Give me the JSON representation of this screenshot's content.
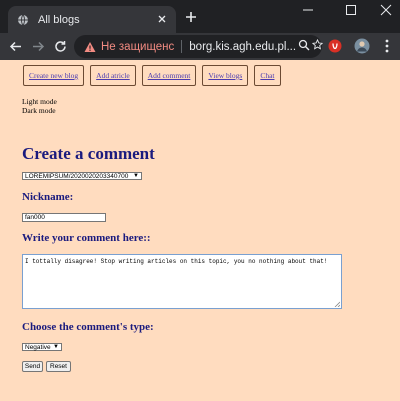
{
  "browser": {
    "tab": {
      "title": "All blogs",
      "favicon": "globe-icon"
    },
    "address_bar": {
      "security_label": "Не защищенс",
      "url": "borg.kis.agh.edu.pl..."
    }
  },
  "page": {
    "nav": [
      {
        "label": "Create new blog"
      },
      {
        "label": "Add atricle"
      },
      {
        "label": "Add comment"
      },
      {
        "label": "View blogs"
      },
      {
        "label": "Chat"
      }
    ],
    "modes": {
      "light": "Light mode",
      "dark": "Dark mode"
    },
    "title": "Create a comment",
    "article_select": {
      "value": "LOREMIPSUM/2020020203340700"
    },
    "nickname_label": "Nickname:",
    "nickname_value": "fan000",
    "comment_label": "Write your comment here::",
    "comment_text": "I tottally disagree! Stop writing articles on this topic, you no nothing about that!",
    "type_label": "Choose the comment's type:",
    "type_select": {
      "value": "Negative"
    },
    "send_label": "Send",
    "reset_label": "Reset"
  },
  "colors": {
    "page_bg": "#ffdcbf",
    "heading": "#1a1a7e",
    "link": "#4b3bb0",
    "chrome_dark": "#202124",
    "chrome_toolbar": "#35363a",
    "insecure": "#f28b82"
  }
}
